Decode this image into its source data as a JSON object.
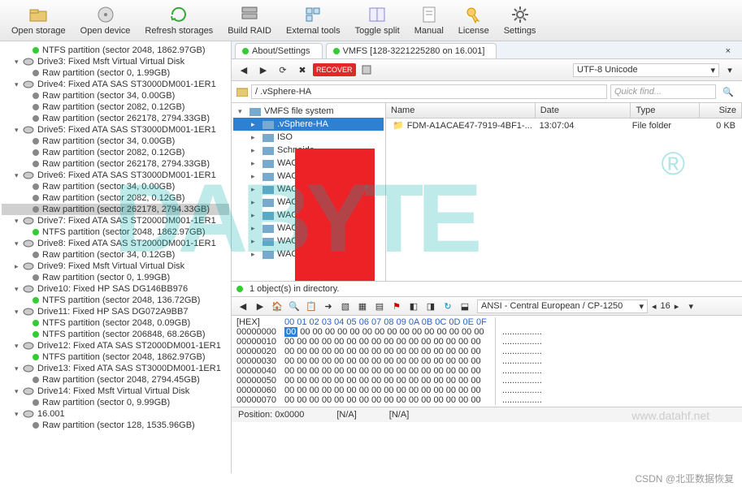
{
  "toolbar": [
    {
      "label": "Open storage"
    },
    {
      "label": "Open device"
    },
    {
      "label": "Refresh storages"
    },
    {
      "label": "Build RAID"
    },
    {
      "label": "External tools"
    },
    {
      "label": "Toggle split"
    },
    {
      "label": "Manual"
    },
    {
      "label": "License"
    },
    {
      "label": "Settings"
    }
  ],
  "tabs": {
    "about": "About/Settings",
    "vmfs": "VMFS [128-3221225280 on 16.001]"
  },
  "encoding": "UTF-8 Unicode",
  "path": "/ .vSphere-HA",
  "quickfind": "Quick find...",
  "fs_root": "VMFS file system",
  "fs_items": [
    ".vSphere-HA",
    "ISO",
    "Schneide",
    "WACN00",
    "WACN00        01",
    "WACN00        02",
    "WACN00",
    "WACN00",
    "WACN00",
    "WACN00",
    "WACN00"
  ],
  "filelist": {
    "headers": {
      "name": "Name",
      "date": "Date",
      "type": "Type",
      "size": "Size"
    },
    "row": {
      "name": "FDM-A1ACAE47-7919-4BF1-...",
      "date": "13:07:04",
      "type": "File folder",
      "size": "0 KB"
    }
  },
  "status_objects": "1 object(s) in directory.",
  "hex": {
    "encoding": "ANSI - Central European / CP-1250",
    "cols": "16",
    "label": "[HEX]",
    "header": "00 01 02 03 04 05 06 07 08 09 0A 0B 0C 0D 0E 0F",
    "offsets": [
      "00000000",
      "00000010",
      "00000020",
      "00000030",
      "00000040",
      "00000050",
      "00000060",
      "00000070"
    ],
    "rowzero": "00 00 00 00 00 00 00 00 00 00 00 00 00 00 00 00",
    "ascii": "................"
  },
  "bottom": {
    "pos": "Position: 0x0000",
    "na": "[N/A]"
  },
  "watermark": "www.datahf.net",
  "wm_big": "DABYTE",
  "csdn": "CSDN @北亚数据恢复",
  "drives": [
    {
      "lvl": 2,
      "dot": "green",
      "label": "NTFS partition (sector 2048, 1862.97GB)"
    },
    {
      "lvl": 1,
      "arrow": "▾",
      "drv": true,
      "label": "Drive3: Fixed Msft Virtual Virtual Disk"
    },
    {
      "lvl": 2,
      "dot": "gray",
      "label": "Raw partition (sector 0, 1.99GB)"
    },
    {
      "lvl": 1,
      "arrow": "▾",
      "drv": true,
      "label": "Drive4: Fixed ATA SAS ST3000DM001-1ER1"
    },
    {
      "lvl": 2,
      "dot": "gray",
      "label": "Raw partition (sector 34, 0.00GB)"
    },
    {
      "lvl": 2,
      "dot": "gray",
      "label": "Raw partition (sector 2082, 0.12GB)"
    },
    {
      "lvl": 2,
      "dot": "gray",
      "label": "Raw partition (sector 262178, 2794.33GB)"
    },
    {
      "lvl": 1,
      "arrow": "▾",
      "drv": true,
      "label": "Drive5: Fixed ATA SAS ST3000DM001-1ER1"
    },
    {
      "lvl": 2,
      "dot": "gray",
      "label": "Raw partition (sector 34, 0.00GB)"
    },
    {
      "lvl": 2,
      "dot": "gray",
      "label": "Raw partition (sector 2082, 0.12GB)"
    },
    {
      "lvl": 2,
      "dot": "gray",
      "label": "Raw partition (sector 262178, 2794.33GB)"
    },
    {
      "lvl": 1,
      "arrow": "▾",
      "drv": true,
      "label": "Drive6: Fixed ATA SAS ST3000DM001-1ER1"
    },
    {
      "lvl": 2,
      "dot": "gray",
      "label": "Raw partition (sector 34, 0.00GB)"
    },
    {
      "lvl": 2,
      "dot": "gray",
      "label": "Raw partition (sector 2082, 0.12GB)"
    },
    {
      "lvl": 2,
      "dot": "gray",
      "sel": true,
      "label": "Raw partition (sector 262178, 2794.33GB)"
    },
    {
      "lvl": 1,
      "arrow": "▾",
      "drv": true,
      "label": "Drive7: Fixed ATA SAS ST2000DM001-1ER1"
    },
    {
      "lvl": 2,
      "dot": "green",
      "label": "NTFS partition (sector 2048, 1862.97GB)"
    },
    {
      "lvl": 1,
      "arrow": "▾",
      "drv": true,
      "label": "Drive8: Fixed ATA SAS ST2000DM001-1ER1"
    },
    {
      "lvl": 2,
      "dot": "gray",
      "label": "Raw partition (sector 34, 0.12GB)"
    },
    {
      "lvl": 1,
      "arrow": "▸",
      "drv": true,
      "label": "Drive9: Fixed Msft Virtual Virtual Disk"
    },
    {
      "lvl": 2,
      "dot": "gray",
      "label": "Raw partition (sector 0, 1.99GB)"
    },
    {
      "lvl": 1,
      "arrow": "▾",
      "drv": true,
      "label": "Drive10: Fixed HP SAS DG146BB976"
    },
    {
      "lvl": 2,
      "dot": "green",
      "label": "NTFS partition (sector 2048, 136.72GB)"
    },
    {
      "lvl": 1,
      "arrow": "▾",
      "drv": true,
      "label": "Drive11: Fixed HP SAS DG072A9BB7"
    },
    {
      "lvl": 2,
      "dot": "green",
      "label": "NTFS partition (sector 2048, 0.09GB)"
    },
    {
      "lvl": 2,
      "dot": "green",
      "label": "NTFS partition (sector 206848, 68.26GB)"
    },
    {
      "lvl": 1,
      "arrow": "▾",
      "drv": true,
      "label": "Drive12: Fixed ATA SAS ST2000DM001-1ER1"
    },
    {
      "lvl": 2,
      "dot": "green",
      "label": "NTFS partition (sector 2048, 1862.97GB)"
    },
    {
      "lvl": 1,
      "arrow": "▾",
      "drv": true,
      "label": "Drive13: Fixed ATA SAS ST3000DM001-1ER1"
    },
    {
      "lvl": 2,
      "dot": "gray",
      "label": "Raw partition (sector 2048, 2794.45GB)"
    },
    {
      "lvl": 1,
      "arrow": "▾",
      "drv": true,
      "label": "Drive14: Fixed Msft Virtual Virtual Disk"
    },
    {
      "lvl": 2,
      "dot": "gray",
      "label": "Raw partition (sector 0, 9.99GB)"
    },
    {
      "lvl": 1,
      "arrow": "▾",
      "drv": true,
      "blue": true,
      "label": "16.001"
    },
    {
      "lvl": 2,
      "dot": "gray",
      "label": "Raw partition (sector 128, 1535.96GB)"
    }
  ]
}
